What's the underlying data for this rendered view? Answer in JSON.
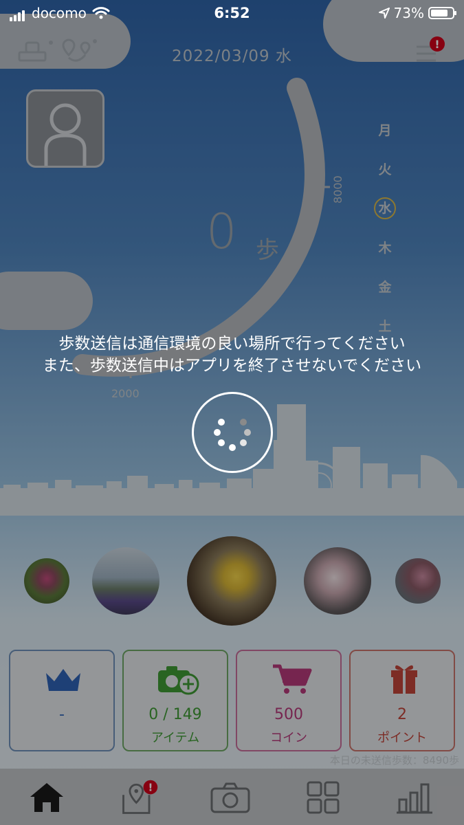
{
  "status_bar": {
    "carrier": "docomo",
    "time": "6:52",
    "battery": "73%"
  },
  "header": {
    "date": "2022/03/09 水"
  },
  "steps": {
    "count": "0",
    "unit": "歩",
    "goal_tick": "8000",
    "low_tick": "2000"
  },
  "weekdays": [
    {
      "label": "月",
      "today": false
    },
    {
      "label": "火",
      "today": false
    },
    {
      "label": "水",
      "today": true
    },
    {
      "label": "木",
      "today": false
    },
    {
      "label": "金",
      "today": false
    },
    {
      "label": "土",
      "today": false
    }
  ],
  "notice": {
    "line1": "歩数送信は通信環境の良い場所で行ってください",
    "line2": "また、歩数送信中はアプリを終了させないでください"
  },
  "cards": {
    "ranking": {
      "value": "-",
      "color": "#2f63b5"
    },
    "items": {
      "value": "0 / 149",
      "label": "アイテム",
      "color": "#3f9a35"
    },
    "coins": {
      "value": "500",
      "label": "コイン",
      "color": "#b53a7a"
    },
    "points": {
      "value": "2",
      "label": "ポイント",
      "color": "#c0443a"
    }
  },
  "unsent_steps": "本日の未送信歩数：8490歩",
  "tabs": [
    {
      "name": "home-icon"
    },
    {
      "name": "map-pin-icon"
    },
    {
      "name": "camera-icon"
    },
    {
      "name": "grid-icon"
    },
    {
      "name": "bar-chart-icon"
    }
  ],
  "colors": {
    "alert": "#d0021b",
    "today_ring": "#d9b84a"
  }
}
